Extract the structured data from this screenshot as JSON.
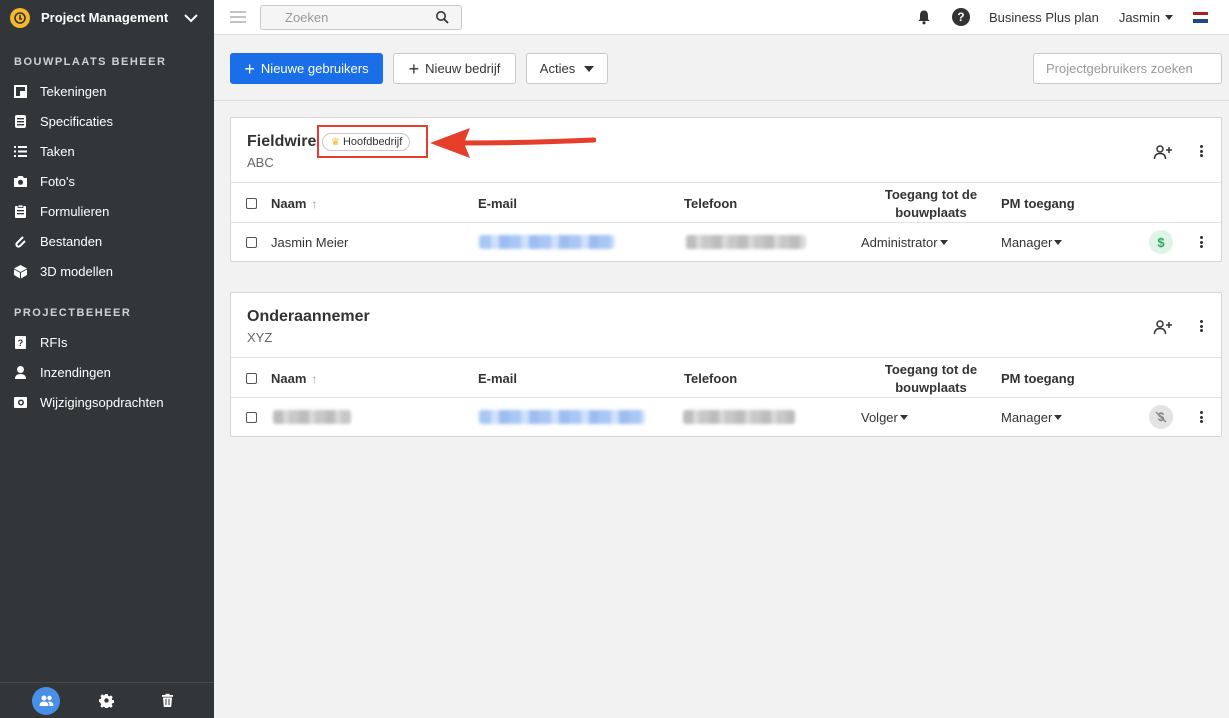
{
  "sidebar": {
    "app_title": "Project Management",
    "sections": [
      {
        "title": "BOUWPLAATS BEHEER",
        "items": [
          {
            "label": "Tekeningen",
            "icon": "plans-icon"
          },
          {
            "label": "Specificaties",
            "icon": "specifications-icon"
          },
          {
            "label": "Taken",
            "icon": "tasks-icon"
          },
          {
            "label": "Foto's",
            "icon": "camera-icon"
          },
          {
            "label": "Formulieren",
            "icon": "forms-icon"
          },
          {
            "label": "Bestanden",
            "icon": "paperclip-icon"
          },
          {
            "label": "3D modellen",
            "icon": "cube-icon"
          }
        ]
      },
      {
        "title": "PROJECTBEHEER",
        "items": [
          {
            "label": "RFIs",
            "icon": "rfi-icon"
          },
          {
            "label": "Inzendingen",
            "icon": "submittals-icon"
          },
          {
            "label": "Wijzigingsopdrachten",
            "icon": "change-orders-icon"
          }
        ]
      }
    ],
    "footer": [
      "people-icon",
      "gear-icon",
      "trash-icon"
    ]
  },
  "topbar": {
    "search_placeholder": "Zoeken",
    "plan": "Business Plus plan",
    "user": "Jasmin",
    "flag_colors": [
      "#ae1c28",
      "#ffffff",
      "#21468b"
    ]
  },
  "toolbar": {
    "new_users": "Nieuwe gebruikers",
    "new_company": "Nieuw bedrijf",
    "actions": "Acties",
    "project_users_search": "Projectgebruikers zoeken"
  },
  "columns": {
    "name": "Naam",
    "email": "E-mail",
    "phone": "Telefoon",
    "access_line1": "Toegang tot de",
    "access_line2": "bouwplaats",
    "pm": "PM toegang"
  },
  "companies": [
    {
      "name": "Fieldwire",
      "sub": "ABC",
      "badge": "Hoofdbedrijf",
      "rows": [
        {
          "name": "Jasmin Meier",
          "access": "Administrator",
          "pm": "Manager",
          "billing": "paid"
        }
      ]
    },
    {
      "name": "Onderaannemer",
      "sub": "XYZ",
      "rows": [
        {
          "name": "",
          "access": "Volger",
          "pm": "Manager",
          "billing": "free"
        }
      ]
    }
  ],
  "colors": {
    "accent": "#1a6fe8",
    "sidebar": "#333638",
    "highlight": "#e53e2a",
    "paid": "#2bab5a"
  }
}
